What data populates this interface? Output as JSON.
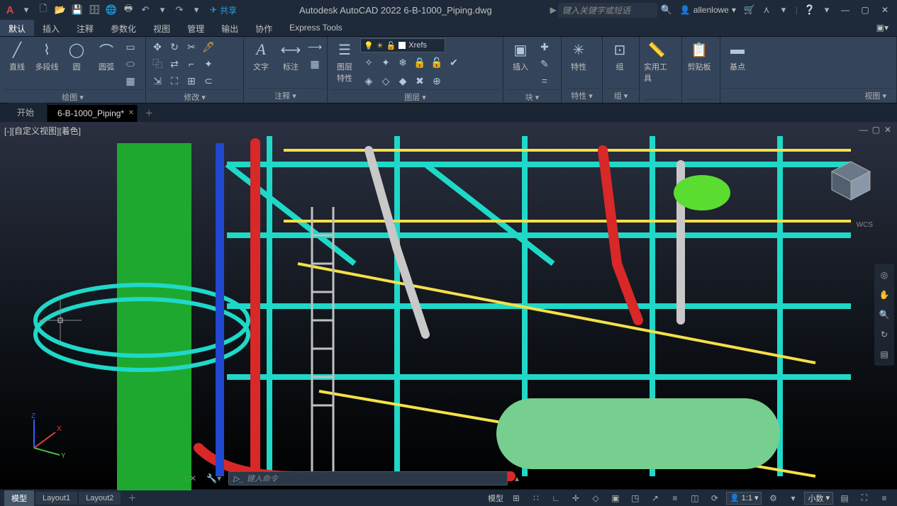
{
  "app": {
    "title": "Autodesk AutoCAD 2022   6-B-1000_Piping.dwg",
    "logo": "A",
    "share_label": "共享",
    "search_placeholder": "键入关键字或短语",
    "user_name": "allenlowe"
  },
  "qat": {
    "menu_dropdown": "▾",
    "new": "🗋",
    "open": "📂",
    "save": "💾",
    "saveas": "🗄",
    "plot": "🖶",
    "undo": "↶",
    "redo": "↷"
  },
  "ribbon_tabs": [
    "默认",
    "插入",
    "注释",
    "参数化",
    "视图",
    "管理",
    "输出",
    "协作",
    "Express Tools"
  ],
  "ribbon": {
    "panels": {
      "draw": {
        "title": "绘图 ▾",
        "items": {
          "line": "直线",
          "polyline": "多段线",
          "circle": "圆",
          "arc": "圆弧"
        }
      },
      "modify": {
        "title": "修改 ▾"
      },
      "annotate": {
        "title": "注释 ▾",
        "text": "文字",
        "dim": "标注"
      },
      "layers": {
        "title": "图层 ▾",
        "props": "图层\n特性",
        "combo": "Xrefs"
      },
      "block": {
        "title": "块 ▾",
        "insert": "插入"
      },
      "props": {
        "title": "特性 ▾",
        "label": "特性"
      },
      "group": {
        "title": "组 ▾",
        "label": "组"
      },
      "utils": {
        "title": "",
        "label": "实用工具"
      },
      "clipboard": {
        "title": "",
        "label": "剪贴板"
      },
      "view": {
        "title": "视图 ▾",
        "label": "基点"
      }
    }
  },
  "doc_tabs": {
    "start": "开始",
    "file": "6-B-1000_Piping*"
  },
  "viewport": {
    "label": "[-][自定义视图][着色]",
    "wcs": "WCS",
    "axes": {
      "x": "X",
      "y": "Y",
      "z": "Z"
    },
    "cmd_placeholder": "键入命令"
  },
  "bottom_tabs": {
    "model": "模型",
    "layout1": "Layout1",
    "layout2": "Layout2"
  },
  "status": {
    "model_label": "模型",
    "scale": "1:1",
    "decimal": "小数"
  }
}
